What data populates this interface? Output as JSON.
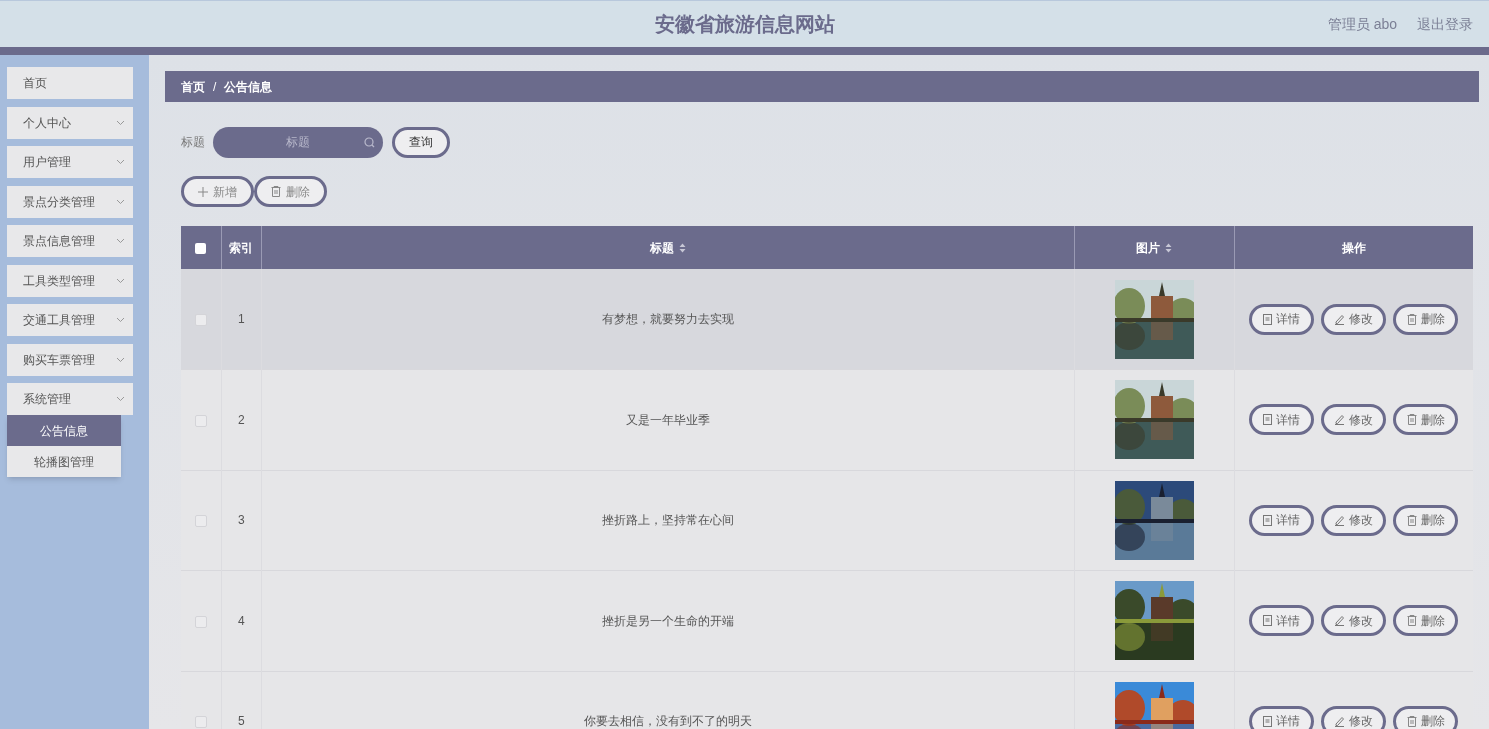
{
  "header": {
    "title": "安徽省旅游信息网站",
    "user": "管理员 abo",
    "logout": "退出登录"
  },
  "sidebar": {
    "items": [
      {
        "label": "首页",
        "has_children": false
      },
      {
        "label": "个人中心",
        "has_children": true
      },
      {
        "label": "用户管理",
        "has_children": true
      },
      {
        "label": "景点分类管理",
        "has_children": true
      },
      {
        "label": "景点信息管理",
        "has_children": true
      },
      {
        "label": "工具类型管理",
        "has_children": true
      },
      {
        "label": "交通工具管理",
        "has_children": true
      },
      {
        "label": "购买车票管理",
        "has_children": true
      },
      {
        "label": "系统管理",
        "has_children": true,
        "children": [
          {
            "label": "公告信息",
            "selected": true
          },
          {
            "label": "轮播图管理",
            "selected": false
          }
        ]
      }
    ]
  },
  "breadcrumb": {
    "items": [
      "首页",
      "公告信息"
    ],
    "separator": "/"
  },
  "search": {
    "label": "标题",
    "placeholder": "标题",
    "button": "查询"
  },
  "actions": [
    "新增",
    "删除"
  ],
  "table": {
    "select_all_checked": false,
    "columns": [
      {
        "label": "索引",
        "sortable": false
      },
      {
        "label": "标题",
        "sortable": true
      },
      {
        "label": "图片",
        "sortable": true
      },
      {
        "label": "操作",
        "sortable": false
      }
    ],
    "rows": [
      {
        "index": "1",
        "title": "有梦想，就要努力去实现",
        "image": {
          "kind": "picture"
        },
        "checked": false,
        "hovered": true,
        "actions": [
          "详情",
          "修改",
          "删除"
        ]
      },
      {
        "index": "2",
        "title": "又是一年毕业季",
        "image": {
          "kind": "picture"
        },
        "checked": false,
        "hovered": false,
        "actions": [
          "详情",
          "修改",
          "删除"
        ]
      },
      {
        "index": "3",
        "title": "挫折路上，坚持常在心间",
        "image": {
          "kind": "picture"
        },
        "checked": false,
        "hovered": false,
        "actions": [
          "详情",
          "修改",
          "删除"
        ]
      },
      {
        "index": "4",
        "title": "挫折是另一个生命的开端",
        "image": {
          "kind": "picture"
        },
        "checked": false,
        "hovered": false,
        "actions": [
          "详情",
          "修改",
          "删除"
        ]
      },
      {
        "index": "5",
        "title": "你要去相信，没有到不了的明天",
        "image": {
          "kind": "picture"
        },
        "checked": false,
        "hovered": false,
        "actions": [
          "详情",
          "修改",
          "删除"
        ]
      }
    ]
  }
}
